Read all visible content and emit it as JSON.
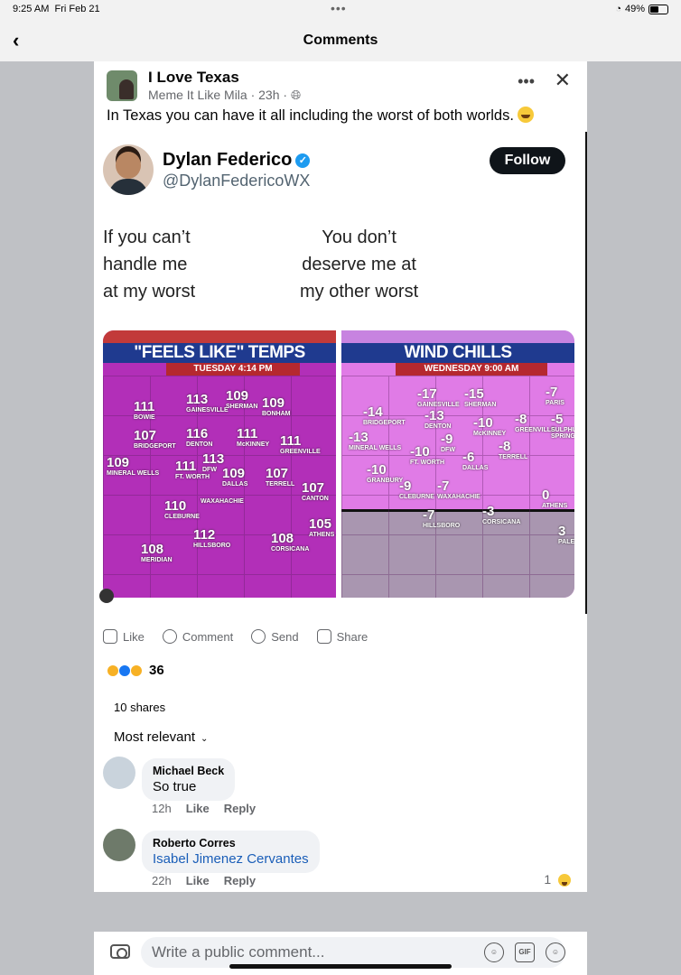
{
  "status": {
    "time": "9:25 AM",
    "date": "Fri Feb 21",
    "battery": "49%",
    "battery_level": 0.49,
    "center_dots": "•••"
  },
  "nav": {
    "back_icon": "‹",
    "title": "Comments"
  },
  "post": {
    "group_name": "I Love Texas",
    "meta": "Meme It Like Mila · 23h ·",
    "more_icon": "•••",
    "close_icon": "✕",
    "caption": "In Texas you can have it all including the worst of both worlds."
  },
  "tweet": {
    "name": "Dylan Federico",
    "verified_icon": "✓",
    "handle": "@DylanFedericoWX",
    "follow_label": "Follow",
    "left_text": "If you can’t\nhandle me\nat my worst",
    "right_text": "You don’t\ndeserve me at\nmy other worst"
  },
  "map_left": {
    "banner": "\"FEELS LIKE\" TEMPS",
    "sub": "TUESDAY 4:14 PM",
    "cities": [
      {
        "val": "111",
        "name": "BOWIE"
      },
      {
        "val": "113",
        "name": "GAINESVILLE"
      },
      {
        "val": "109",
        "name": "SHERMAN"
      },
      {
        "val": "109",
        "name": "BONHAM"
      },
      {
        "val": "107",
        "name": "BRIDGEPORT"
      },
      {
        "val": "116",
        "name": "DENTON"
      },
      {
        "val": "111",
        "name": "McKINNEY"
      },
      {
        "val": "111",
        "name": "GREENVILLE"
      },
      {
        "val": "109",
        "name": "MINERAL WELLS"
      },
      {
        "val": "113",
        "name": "DFW"
      },
      {
        "val": "111",
        "name": "FT. WORTH"
      },
      {
        "val": "109",
        "name": "DALLAS"
      },
      {
        "val": "107",
        "name": "TERRELL"
      },
      {
        "val": "107",
        "name": "CANTON"
      },
      {
        "val": "110",
        "name": "CLEBURNE"
      },
      {
        "val": "",
        "name": "WAXAHACHIE"
      },
      {
        "val": "112",
        "name": "HILLSBORO"
      },
      {
        "val": "108",
        "name": "CORSICANA"
      },
      {
        "val": "105",
        "name": "ATHENS"
      },
      {
        "val": "108",
        "name": "MERIDIAN"
      }
    ]
  },
  "map_right": {
    "banner": "WIND CHILLS",
    "sub": "WEDNESDAY 9:00 AM",
    "cities": [
      {
        "val": "-17",
        "name": "GAINESVILLE"
      },
      {
        "val": "-15",
        "name": "SHERMAN"
      },
      {
        "val": "-7",
        "name": "PARIS"
      },
      {
        "val": "-14",
        "name": "BRIDGEPORT"
      },
      {
        "val": "-13",
        "name": "DENTON"
      },
      {
        "val": "-10",
        "name": "McKINNEY"
      },
      {
        "val": "-8",
        "name": "GREENVILLE"
      },
      {
        "val": "-5",
        "name": "SULPHUR SPRINGS"
      },
      {
        "val": "-13",
        "name": "MINERAL WELLS"
      },
      {
        "val": "-9",
        "name": "DFW"
      },
      {
        "val": "-10",
        "name": "FT. WORTH"
      },
      {
        "val": "-6",
        "name": "DALLAS"
      },
      {
        "val": "-8",
        "name": "TERRELL"
      },
      {
        "val": "-10",
        "name": "GRANBURY"
      },
      {
        "val": "-9",
        "name": "CLEBURNE"
      },
      {
        "val": "-7",
        "name": "WAXAHACHIE"
      },
      {
        "val": "-7",
        "name": "HILLSBORO"
      },
      {
        "val": "-3",
        "name": "CORSICANA"
      },
      {
        "val": "0",
        "name": "ATHENS"
      },
      {
        "val": "3",
        "name": "PALEST"
      }
    ]
  },
  "actions": {
    "like": "Like",
    "comment": "Comment",
    "send": "Send",
    "share": "Share"
  },
  "reactions": {
    "count": "36",
    "colors": [
      "#f7b125",
      "#1877f2",
      "#f7b125"
    ]
  },
  "shares_label": "10 shares",
  "sort_label": "Most relevant",
  "comments": [
    {
      "name": "Michael Beck",
      "text": "So true",
      "time": "12h",
      "like": "Like",
      "reply": "Reply"
    },
    {
      "name": "Roberto Corres",
      "text": "Isabel Jimenez Cervantes",
      "time": "22h",
      "like": "Like",
      "reply": "Reply",
      "reaction_count": "1"
    }
  ],
  "composer": {
    "placeholder": "Write a public comment...",
    "gif_label": "GIF"
  }
}
